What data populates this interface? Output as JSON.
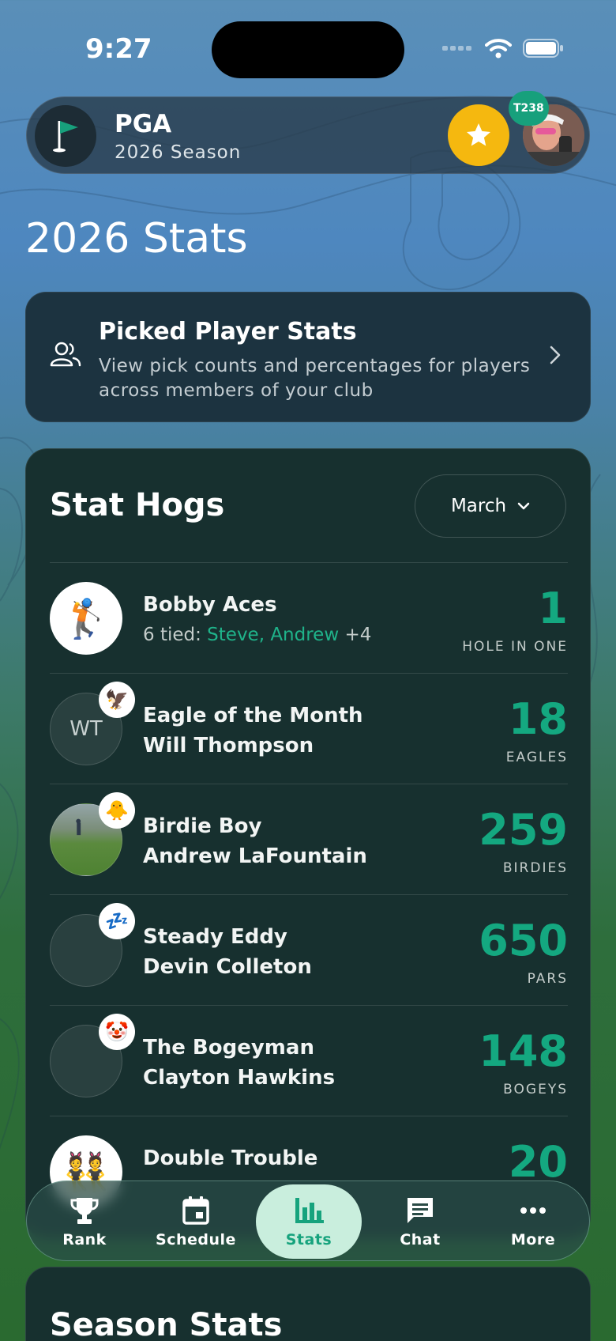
{
  "status_bar": {
    "time": "9:27"
  },
  "header": {
    "league": "PGA",
    "season": "2026 Season",
    "rank_badge": "T238"
  },
  "page_title": "2026 Stats",
  "picked_card": {
    "title": "Picked Player Stats",
    "description": "View pick counts and percentages for players across members of your club"
  },
  "stat_hogs": {
    "title": "Stat Hogs",
    "month": "March",
    "rows": [
      {
        "title": "Bobby Aces",
        "tied_prefix": "6 tied: ",
        "tied_names": "Steve, Andrew",
        "tied_more": " +4",
        "value": "1",
        "label": "HOLE IN ONE",
        "avatar_emoji": "🏌️"
      },
      {
        "title": "Eagle of the Month",
        "name": "Will Thompson",
        "value": "18",
        "label": "EAGLES",
        "initials": "WT",
        "badge_emoji": "🦅"
      },
      {
        "title": "Birdie Boy",
        "name": "Andrew LaFountain",
        "value": "259",
        "label": "BIRDIES",
        "badge_emoji": "🐥"
      },
      {
        "title": "Steady Eddy",
        "name": "Devin Colleton",
        "value": "650",
        "label": "PARS",
        "badge_emoji": "💤"
      },
      {
        "title": "The Bogeyman",
        "name": "Clayton Hawkins",
        "value": "148",
        "label": "BOGEYS",
        "badge_emoji": "🤡"
      },
      {
        "title": "Double Trouble",
        "value": "20",
        "avatar_emoji": "👯"
      }
    ]
  },
  "season_stats": {
    "title": "Season Stats"
  },
  "tab_bar": {
    "tabs": [
      {
        "label": "Rank",
        "icon": "trophy-icon"
      },
      {
        "label": "Schedule",
        "icon": "calendar-icon"
      },
      {
        "label": "Stats",
        "icon": "bar-chart-icon",
        "active": true
      },
      {
        "label": "Chat",
        "icon": "chat-icon"
      },
      {
        "label": "More",
        "icon": "more-icon"
      }
    ]
  },
  "colors": {
    "accent": "#14a880",
    "star": "#f5b80f",
    "active_tab_bg": "#c9eedd"
  }
}
